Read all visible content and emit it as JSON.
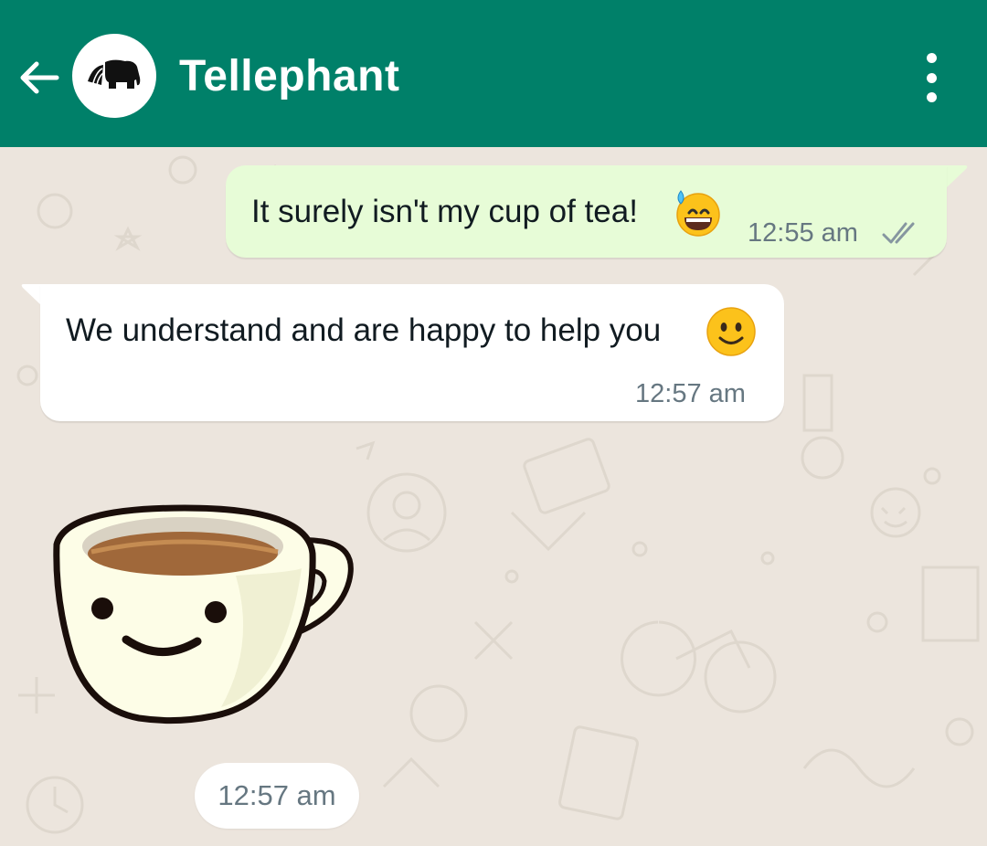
{
  "header": {
    "title": "Tellephant",
    "back_icon": "arrow-left-icon",
    "avatar_icon": "elephant-logo-icon",
    "menu_icon": "more-vertical-icon",
    "bg_color": "#008069"
  },
  "messages": [
    {
      "direction": "outgoing",
      "text": "It surely isn't my cup of tea!",
      "emoji": "grinning-face-with-sweat-icon",
      "time": "12:55 am",
      "status_icon": "double-check-icon",
      "bg_color": "#e7fcd7"
    },
    {
      "direction": "incoming",
      "text": "We understand and are happy to help you",
      "emoji": "slightly-smiling-face-icon",
      "time": "12:57 am",
      "bg_color": "#ffffff"
    },
    {
      "direction": "incoming",
      "type": "sticker",
      "sticker": "smiling-teacup-sticker",
      "time": "12:57 am"
    }
  ],
  "chat": {
    "wallpaper_color": "#ece5dd"
  }
}
